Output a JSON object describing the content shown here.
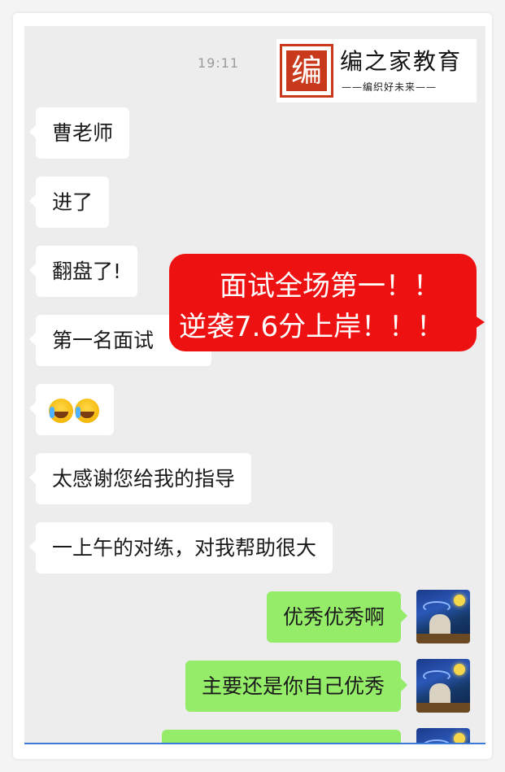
{
  "time": "19:11",
  "logo": {
    "mark": "编",
    "name": "编之家教育",
    "tagline": "——编织好未来——"
  },
  "callout": {
    "line1": "面试全场第一！！",
    "line2": "逆袭7.6分上岸！！！"
  },
  "messages_left": [
    "曹老师",
    "进了",
    "翻盘了!",
    "第一名面试",
    "",
    "太感谢您给我的指导",
    "一上午的对练，对我帮助很大"
  ],
  "messages_right": [
    "优秀优秀啊",
    "主要还是你自己优秀",
    ""
  ],
  "emoji_names": [
    "crying-laughing-icon",
    "crying-laughing-icon"
  ],
  "colors": {
    "sent_bubble": "#95ec69",
    "received_bubble": "#ffffff",
    "callout": "#ee1111",
    "logo_red": "#c93a1c"
  }
}
